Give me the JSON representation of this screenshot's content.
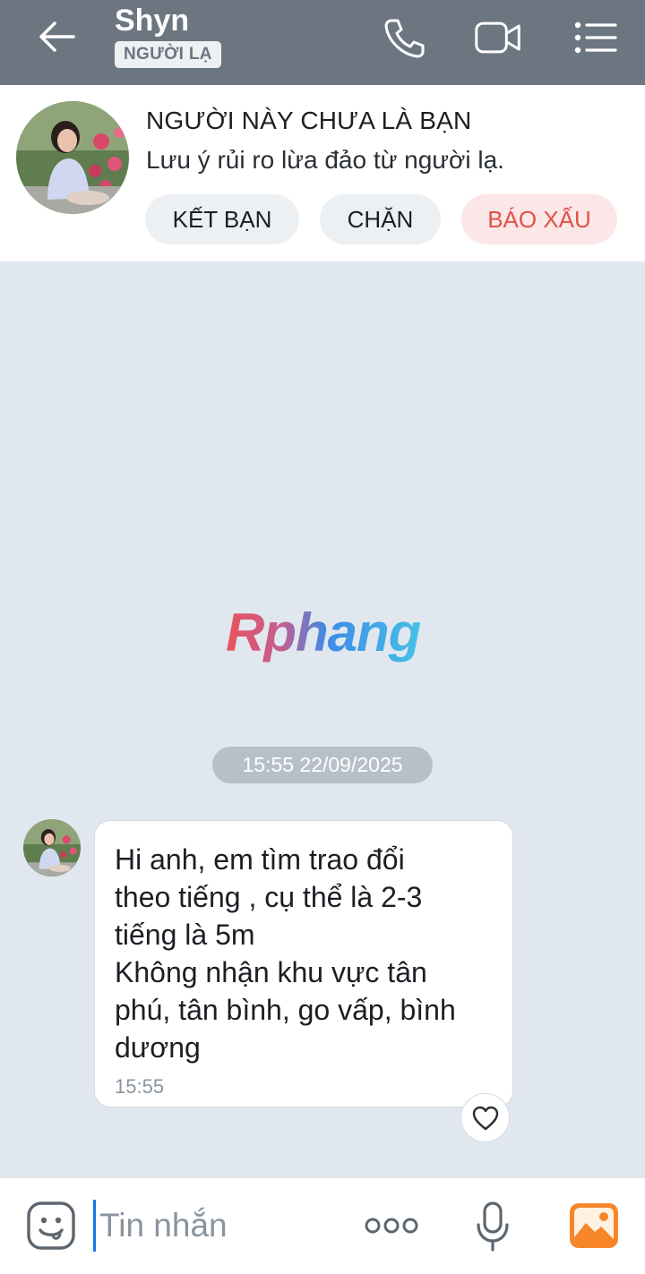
{
  "header": {
    "title": "Shyn",
    "badge": "NGƯỜI LẠ",
    "icons": [
      "back-arrow-icon",
      "phone-icon",
      "video-call-icon",
      "menu-list-icon"
    ],
    "background": "#6c7681"
  },
  "stranger_panel": {
    "title": "NGƯỜI NÀY CHƯA LÀ BẠN",
    "subtitle": "Lưu ý rủi ro lừa đảo từ người lạ.",
    "add_friend_label": "KẾT BẠN",
    "block_label": "CHẶN",
    "report_label": "BÁO XẤU",
    "report_color": "#e2514a"
  },
  "watermark": "Rphang",
  "chat": {
    "date_chip": "15:55 22/09/2025",
    "messages": [
      {
        "text": "Hi anh, em tìm trao đổi\ntheo tiếng , cụ thể là 2-3\ntiếng là 5m\nKhông nhận khu vực tân\nphú, tân bình, go vấp, bình\ndương",
        "time": "15:55"
      }
    ]
  },
  "composer": {
    "placeholder": "Tin nhắn",
    "icons": [
      "emoji-icon",
      "more-options-icon",
      "microphone-icon",
      "image-gallery-icon"
    ],
    "accent": "#1a73e8",
    "image_icon_color": "#f7862b"
  }
}
